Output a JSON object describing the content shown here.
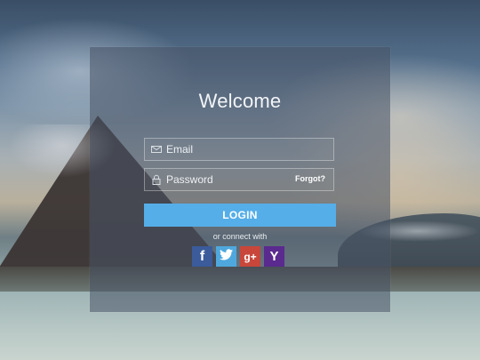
{
  "title": "Welcome",
  "form": {
    "email_placeholder": "Email",
    "password_placeholder": "Password",
    "forgot_label": "Forgot?",
    "login_label": "LOGIN",
    "connect_text": "or connect with"
  },
  "social": [
    {
      "name": "facebook",
      "glyph": "f",
      "color": "#3b5b9a"
    },
    {
      "name": "twitter",
      "glyph": "",
      "color": "#4fa8dd"
    },
    {
      "name": "google-plus",
      "glyph": "g+",
      "color": "#c8463a"
    },
    {
      "name": "yahoo",
      "glyph": "Y",
      "color": "#5a2a8f"
    }
  ],
  "colors": {
    "panel": "#485466",
    "accent": "#55aee8"
  }
}
